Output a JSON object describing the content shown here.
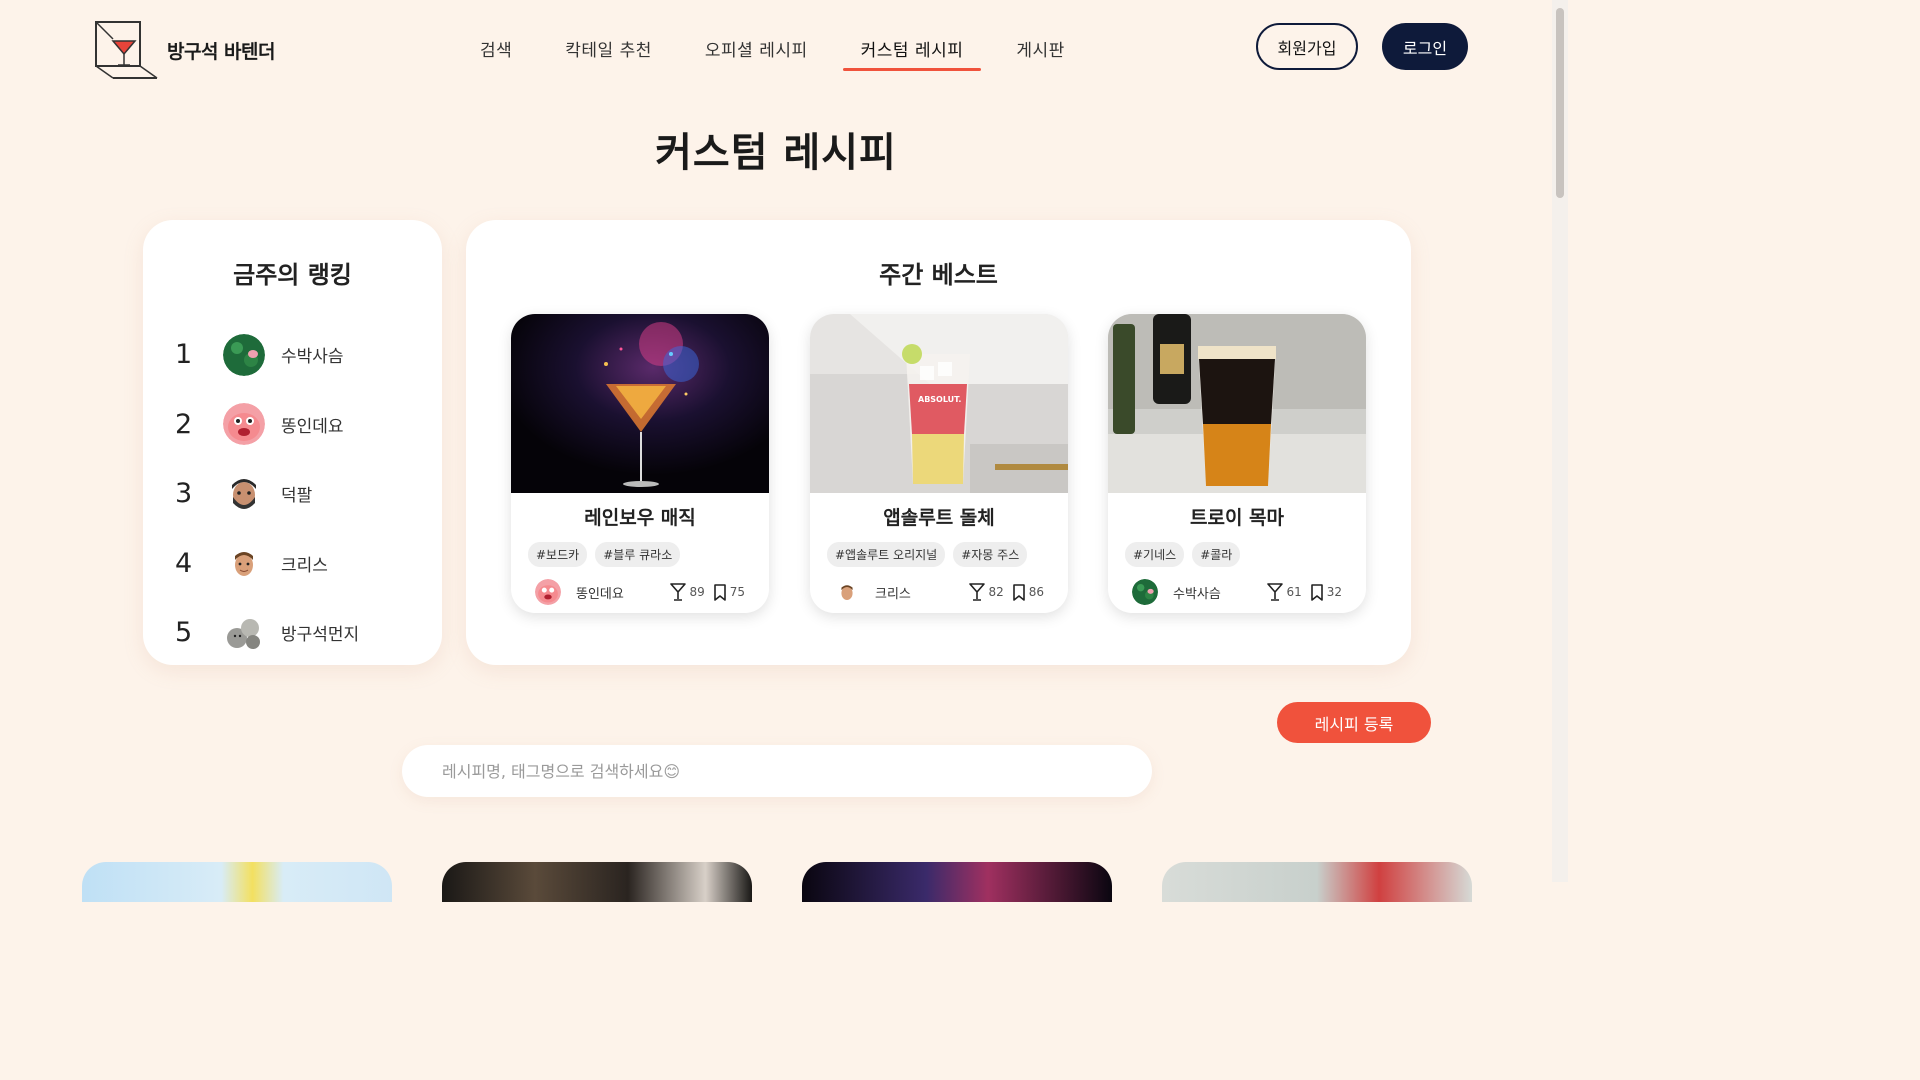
{
  "header": {
    "brand": "방구석 바텐더",
    "nav": [
      {
        "label": "검색",
        "active": false
      },
      {
        "label": "칵테일 추천",
        "active": false
      },
      {
        "label": "오피셜 레시피",
        "active": false
      },
      {
        "label": "커스텀 레시피",
        "active": true
      },
      {
        "label": "게시판",
        "active": false
      }
    ],
    "signup_label": "회원가입",
    "login_label": "로그인"
  },
  "page_title": "커스텀 레시피",
  "ranking": {
    "title": "금주의 랭킹",
    "items": [
      {
        "rank": "1",
        "name": "수박사슴"
      },
      {
        "rank": "2",
        "name": "똥인데요"
      },
      {
        "rank": "3",
        "name": "덕팔"
      },
      {
        "rank": "4",
        "name": "크리스"
      },
      {
        "rank": "5",
        "name": "방구석먼지"
      }
    ]
  },
  "weekly_best": {
    "title": "주간 베스트",
    "recipes": [
      {
        "name": "레인보우 매직",
        "tags": [
          "#보드카",
          "#블루 큐라소"
        ],
        "author": "똥인데요",
        "likes": "89",
        "bookmarks": "75"
      },
      {
        "name": "앱솔루트 돌체",
        "tags": [
          "#앱솔루트 오리지널",
          "#자몽 주스"
        ],
        "author": "크리스",
        "likes": "82",
        "bookmarks": "86"
      },
      {
        "name": "트로이 목마",
        "tags": [
          "#기네스",
          "#콜라"
        ],
        "author": "수박사슴",
        "likes": "61",
        "bookmarks": "32"
      }
    ]
  },
  "register_label": "레시피 등록",
  "search": {
    "placeholder": "레시피명, 태그명으로 검색하세요😊",
    "value": ""
  },
  "colors": {
    "accent": "#f0523c",
    "navy": "#0e1a3a",
    "background": "#fdf3ea"
  }
}
